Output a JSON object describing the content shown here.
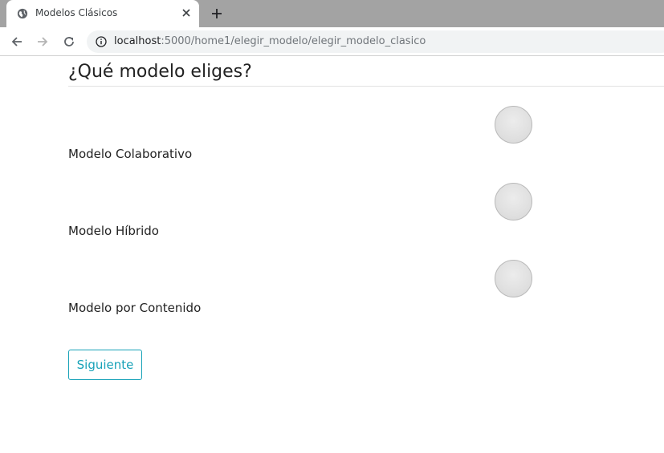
{
  "browser": {
    "tab": {
      "title": "Modelos Clásicos",
      "icon": "globe-icon"
    },
    "address": {
      "host": "localhost",
      "path": ":5000/home1/elegir_modelo/elegir_modelo_clasico"
    }
  },
  "page": {
    "heading": "¿Qué modelo eliges?",
    "options": [
      {
        "label": "Modelo Colaborativo",
        "selected": false
      },
      {
        "label": "Modelo Híbrido",
        "selected": false
      },
      {
        "label": "Modelo por Contenido",
        "selected": false
      }
    ],
    "next_button": "Siguiente"
  },
  "colors": {
    "tab_strip": "#a3a3a3",
    "accent": "#17a2b8"
  }
}
